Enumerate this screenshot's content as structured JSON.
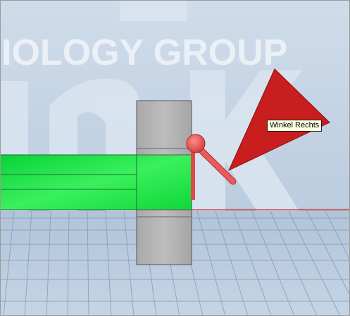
{
  "viewport": {
    "background_text": "IOLOGY GROUP",
    "tooltip_text": "Winkel Rechts"
  },
  "colors": {
    "sky_top": "#c9d9ea",
    "sky_bottom": "#b4c7dc",
    "floor": "#b9cbe0",
    "grid_line": "#7a8da6",
    "logo_shape": "#d9e4ef",
    "green_part": "#11e33c",
    "grey_block": "#b3b3b3",
    "red_sensor": "#e84c4c",
    "red_cone": "#c81e1e",
    "red_line": "#d23c3c",
    "tooltip_bg": "#ffffe1"
  },
  "icons": [
    "sensor-ball-icon",
    "sensor-cone-icon"
  ]
}
